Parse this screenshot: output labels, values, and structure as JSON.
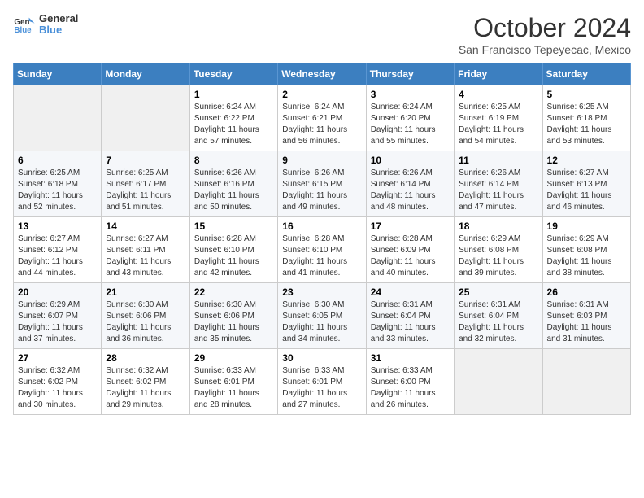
{
  "header": {
    "logo_line1": "General",
    "logo_line2": "Blue",
    "month": "October 2024",
    "location": "San Francisco Tepeyecac, Mexico"
  },
  "days_of_week": [
    "Sunday",
    "Monday",
    "Tuesday",
    "Wednesday",
    "Thursday",
    "Friday",
    "Saturday"
  ],
  "weeks": [
    [
      {
        "day": "",
        "info": ""
      },
      {
        "day": "",
        "info": ""
      },
      {
        "day": "1",
        "info": "Sunrise: 6:24 AM\nSunset: 6:22 PM\nDaylight: 11 hours and 57 minutes."
      },
      {
        "day": "2",
        "info": "Sunrise: 6:24 AM\nSunset: 6:21 PM\nDaylight: 11 hours and 56 minutes."
      },
      {
        "day": "3",
        "info": "Sunrise: 6:24 AM\nSunset: 6:20 PM\nDaylight: 11 hours and 55 minutes."
      },
      {
        "day": "4",
        "info": "Sunrise: 6:25 AM\nSunset: 6:19 PM\nDaylight: 11 hours and 54 minutes."
      },
      {
        "day": "5",
        "info": "Sunrise: 6:25 AM\nSunset: 6:18 PM\nDaylight: 11 hours and 53 minutes."
      }
    ],
    [
      {
        "day": "6",
        "info": "Sunrise: 6:25 AM\nSunset: 6:18 PM\nDaylight: 11 hours and 52 minutes."
      },
      {
        "day": "7",
        "info": "Sunrise: 6:25 AM\nSunset: 6:17 PM\nDaylight: 11 hours and 51 minutes."
      },
      {
        "day": "8",
        "info": "Sunrise: 6:26 AM\nSunset: 6:16 PM\nDaylight: 11 hours and 50 minutes."
      },
      {
        "day": "9",
        "info": "Sunrise: 6:26 AM\nSunset: 6:15 PM\nDaylight: 11 hours and 49 minutes."
      },
      {
        "day": "10",
        "info": "Sunrise: 6:26 AM\nSunset: 6:14 PM\nDaylight: 11 hours and 48 minutes."
      },
      {
        "day": "11",
        "info": "Sunrise: 6:26 AM\nSunset: 6:14 PM\nDaylight: 11 hours and 47 minutes."
      },
      {
        "day": "12",
        "info": "Sunrise: 6:27 AM\nSunset: 6:13 PM\nDaylight: 11 hours and 46 minutes."
      }
    ],
    [
      {
        "day": "13",
        "info": "Sunrise: 6:27 AM\nSunset: 6:12 PM\nDaylight: 11 hours and 44 minutes."
      },
      {
        "day": "14",
        "info": "Sunrise: 6:27 AM\nSunset: 6:11 PM\nDaylight: 11 hours and 43 minutes."
      },
      {
        "day": "15",
        "info": "Sunrise: 6:28 AM\nSunset: 6:10 PM\nDaylight: 11 hours and 42 minutes."
      },
      {
        "day": "16",
        "info": "Sunrise: 6:28 AM\nSunset: 6:10 PM\nDaylight: 11 hours and 41 minutes."
      },
      {
        "day": "17",
        "info": "Sunrise: 6:28 AM\nSunset: 6:09 PM\nDaylight: 11 hours and 40 minutes."
      },
      {
        "day": "18",
        "info": "Sunrise: 6:29 AM\nSunset: 6:08 PM\nDaylight: 11 hours and 39 minutes."
      },
      {
        "day": "19",
        "info": "Sunrise: 6:29 AM\nSunset: 6:08 PM\nDaylight: 11 hours and 38 minutes."
      }
    ],
    [
      {
        "day": "20",
        "info": "Sunrise: 6:29 AM\nSunset: 6:07 PM\nDaylight: 11 hours and 37 minutes."
      },
      {
        "day": "21",
        "info": "Sunrise: 6:30 AM\nSunset: 6:06 PM\nDaylight: 11 hours and 36 minutes."
      },
      {
        "day": "22",
        "info": "Sunrise: 6:30 AM\nSunset: 6:06 PM\nDaylight: 11 hours and 35 minutes."
      },
      {
        "day": "23",
        "info": "Sunrise: 6:30 AM\nSunset: 6:05 PM\nDaylight: 11 hours and 34 minutes."
      },
      {
        "day": "24",
        "info": "Sunrise: 6:31 AM\nSunset: 6:04 PM\nDaylight: 11 hours and 33 minutes."
      },
      {
        "day": "25",
        "info": "Sunrise: 6:31 AM\nSunset: 6:04 PM\nDaylight: 11 hours and 32 minutes."
      },
      {
        "day": "26",
        "info": "Sunrise: 6:31 AM\nSunset: 6:03 PM\nDaylight: 11 hours and 31 minutes."
      }
    ],
    [
      {
        "day": "27",
        "info": "Sunrise: 6:32 AM\nSunset: 6:02 PM\nDaylight: 11 hours and 30 minutes."
      },
      {
        "day": "28",
        "info": "Sunrise: 6:32 AM\nSunset: 6:02 PM\nDaylight: 11 hours and 29 minutes."
      },
      {
        "day": "29",
        "info": "Sunrise: 6:33 AM\nSunset: 6:01 PM\nDaylight: 11 hours and 28 minutes."
      },
      {
        "day": "30",
        "info": "Sunrise: 6:33 AM\nSunset: 6:01 PM\nDaylight: 11 hours and 27 minutes."
      },
      {
        "day": "31",
        "info": "Sunrise: 6:33 AM\nSunset: 6:00 PM\nDaylight: 11 hours and 26 minutes."
      },
      {
        "day": "",
        "info": ""
      },
      {
        "day": "",
        "info": ""
      }
    ]
  ]
}
